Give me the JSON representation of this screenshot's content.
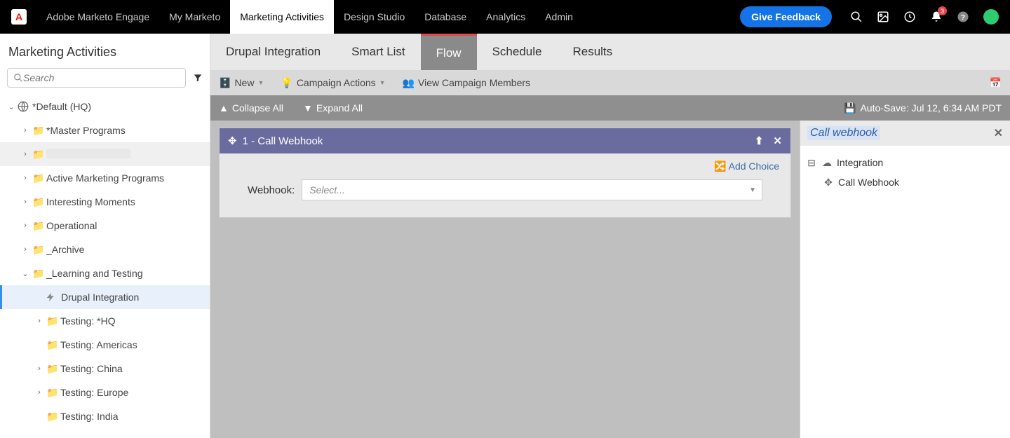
{
  "topbar": {
    "brand": "Adobe Marketo Engage",
    "logo_letter": "A",
    "nav": [
      "My Marketo",
      "Marketing Activities",
      "Design Studio",
      "Database",
      "Analytics",
      "Admin"
    ],
    "active_nav_index": 1,
    "feedback": "Give Feedback",
    "notification_count": "3"
  },
  "sidebar": {
    "title": "Marketing Activities",
    "search_placeholder": "Search",
    "root_label": "*Default (HQ)",
    "folders": [
      {
        "label": "*Master Programs",
        "expandable": true
      },
      {
        "label": "",
        "expandable": true,
        "redacted": true,
        "shaded": true
      },
      {
        "label": "Active Marketing Programs",
        "expandable": true
      },
      {
        "label": "Interesting Moments",
        "expandable": true
      },
      {
        "label": "Operational",
        "expandable": true
      },
      {
        "label": "_Archive",
        "expandable": true
      }
    ],
    "learning_label": "_Learning and Testing",
    "selected_item": "Drupal Integration",
    "sub_items": [
      {
        "label": "Testing: *HQ",
        "expandable": true
      },
      {
        "label": "Testing: Americas",
        "expandable": false
      },
      {
        "label": "Testing: China",
        "expandable": true
      },
      {
        "label": "Testing: Europe",
        "expandable": true
      },
      {
        "label": "Testing: India",
        "expandable": false
      }
    ]
  },
  "tabs": {
    "title": "Drupal Integration",
    "items": [
      "Smart List",
      "Flow",
      "Schedule",
      "Results"
    ],
    "active_index": 1
  },
  "toolbar": {
    "new": "New",
    "actions": "Campaign Actions",
    "view_members": "View Campaign Members"
  },
  "subbar": {
    "collapse": "Collapse All",
    "expand": "Expand All",
    "autosave": "Auto-Save: Jul 12, 6:34 AM PDT"
  },
  "step": {
    "title": "1 - Call Webhook",
    "add_choice": "Add Choice",
    "field_label": "Webhook:",
    "placeholder": "Select..."
  },
  "rpanel": {
    "title": "Call webhook",
    "group": "Integration",
    "item": "Call Webhook"
  }
}
